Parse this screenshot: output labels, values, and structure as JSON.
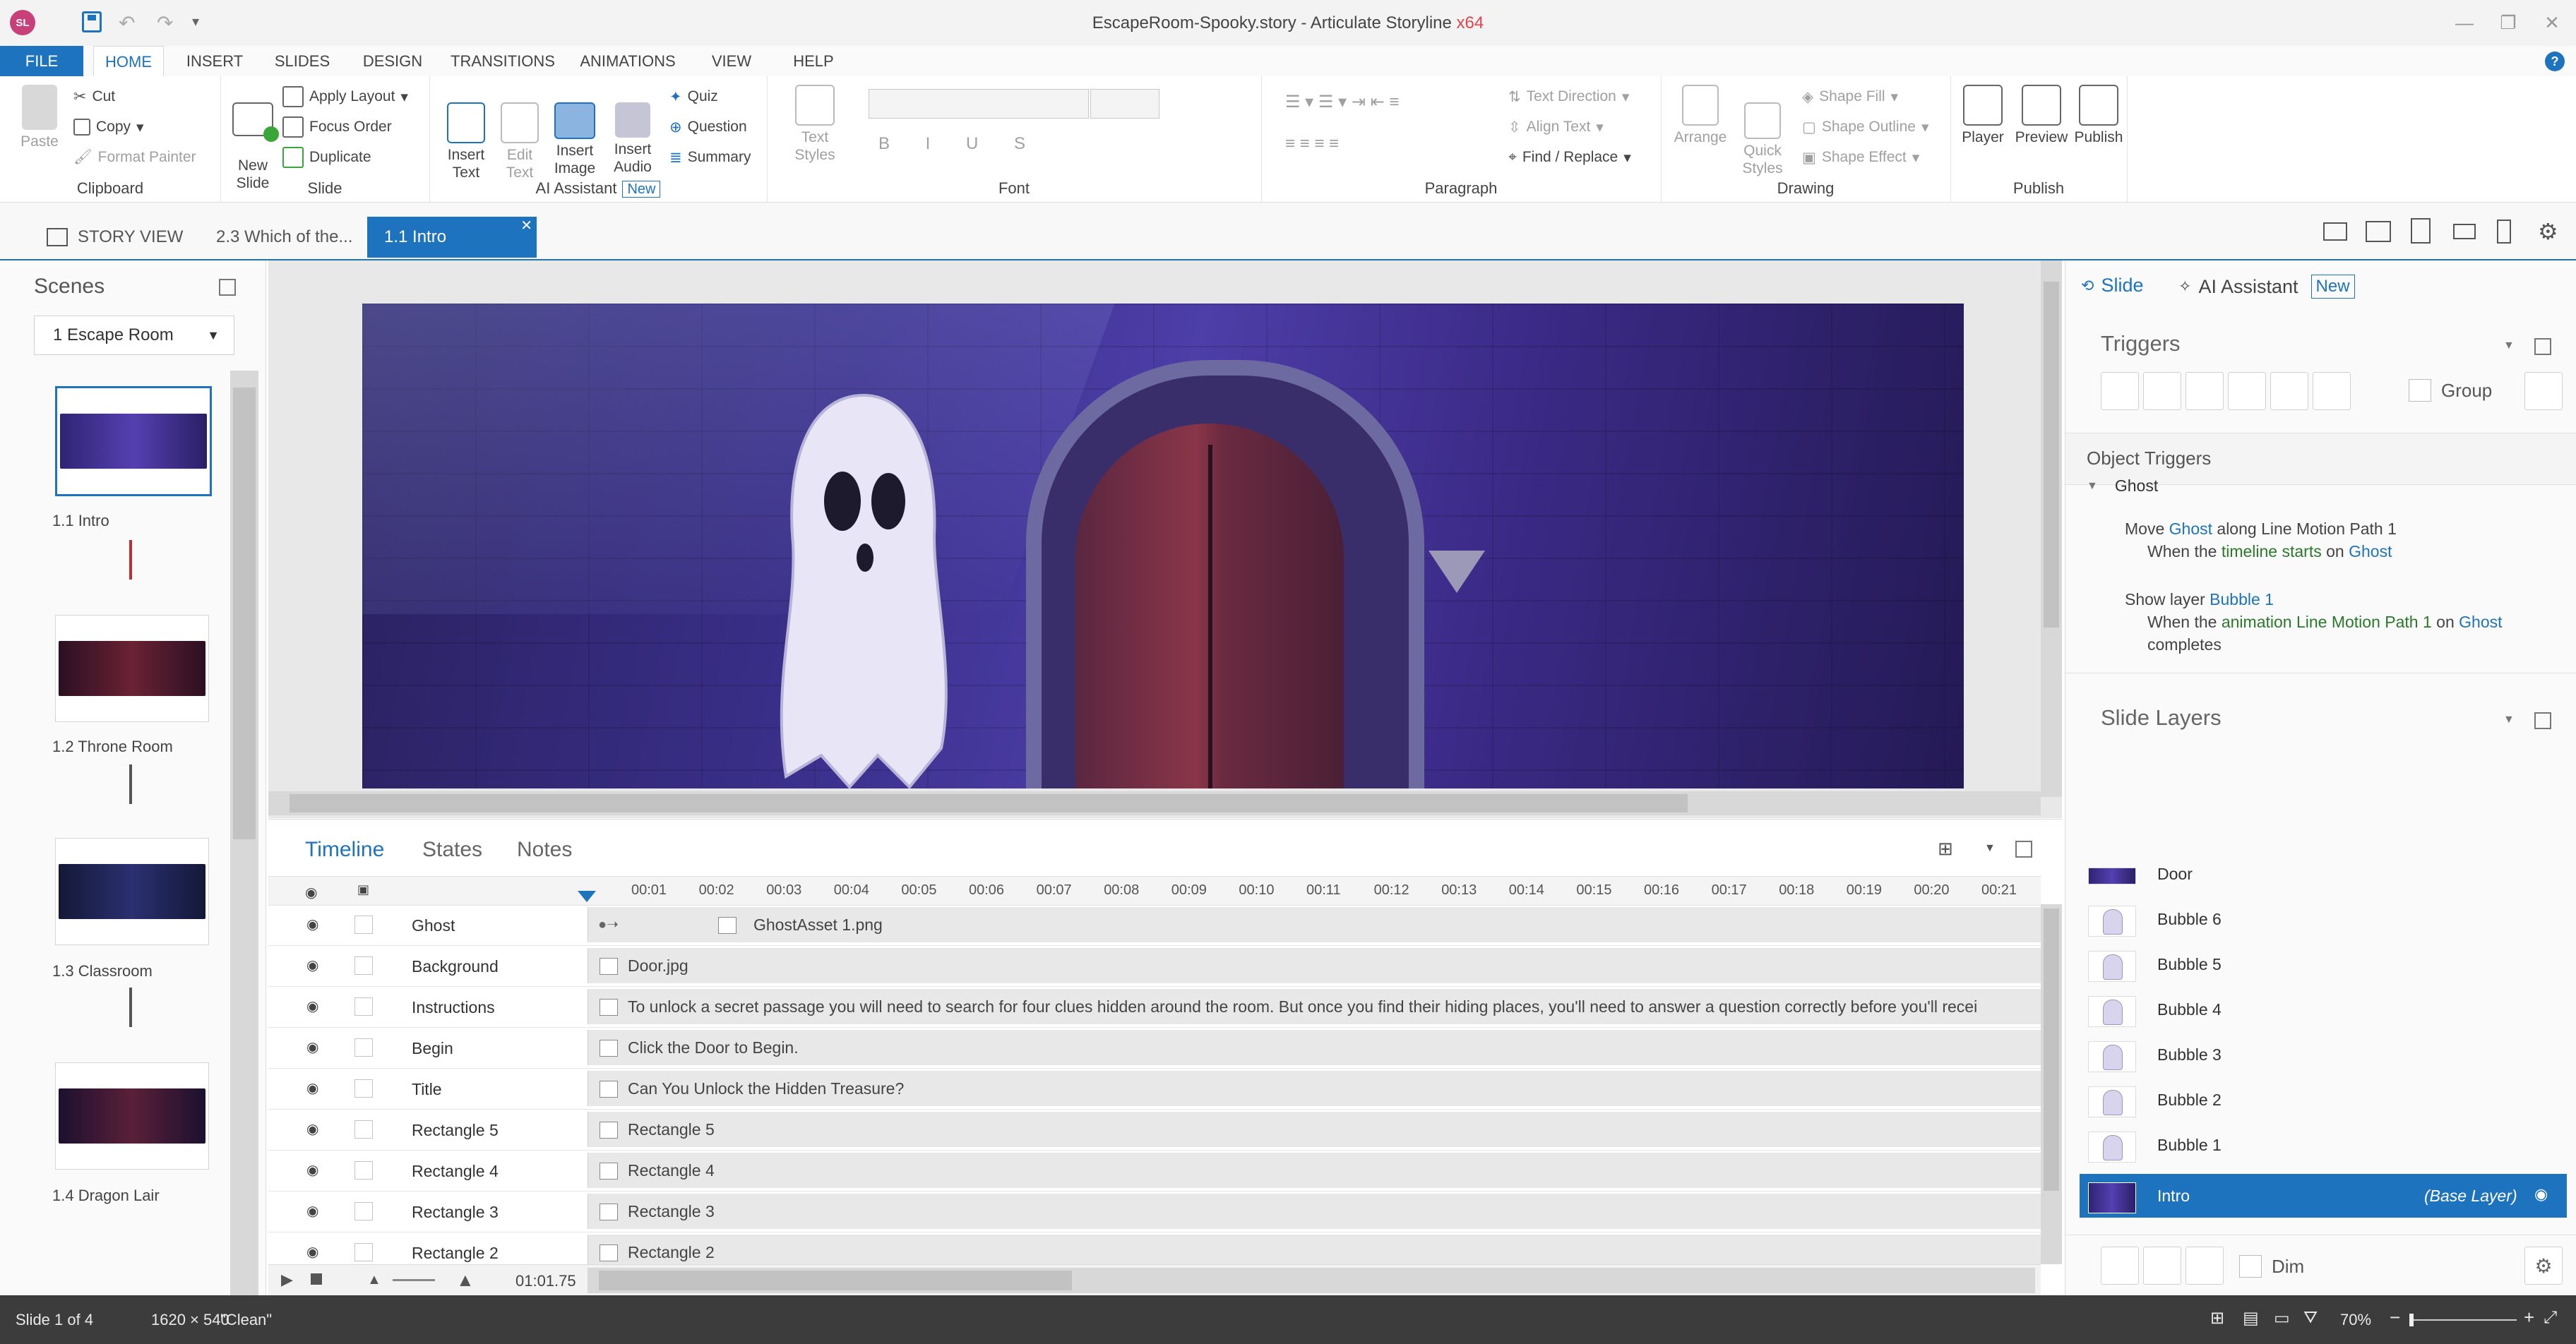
{
  "window": {
    "title": "EscapeRoom-Spooky.story - Articulate Storyline",
    "arch": "x64",
    "app_badge": "SL"
  },
  "menu": {
    "tabs": [
      "FILE",
      "HOME",
      "INSERT",
      "SLIDES",
      "DESIGN",
      "TRANSITIONS",
      "ANIMATIONS",
      "VIEW",
      "HELP"
    ],
    "active": "HOME"
  },
  "ribbon": {
    "clipboard": {
      "label": "Clipboard",
      "paste": "Paste",
      "cut": "Cut",
      "copy": "Copy",
      "format_painter": "Format Painter"
    },
    "slide": {
      "label": "Slide",
      "new_slide": "New\nSlide",
      "apply_layout": "Apply Layout",
      "focus_order": "Focus Order",
      "duplicate": "Duplicate"
    },
    "ai": {
      "label": "AI Assistant",
      "new_badge": "New",
      "insert_text": "Insert\nText",
      "edit_text": "Edit\nText",
      "insert_image": "Insert\nImage",
      "insert_audio": "Insert\nAudio",
      "quiz": "Quiz",
      "question": "Question",
      "summary": "Summary"
    },
    "font": {
      "label": "Font",
      "text_styles": "Text Styles"
    },
    "paragraph": {
      "label": "Paragraph",
      "text_direction": "Text Direction",
      "align_text": "Align Text",
      "find_replace": "Find / Replace"
    },
    "drawing": {
      "label": "Drawing",
      "arrange": "Arrange",
      "quick_styles": "Quick\nStyles",
      "shape_fill": "Shape Fill",
      "shape_outline": "Shape Outline",
      "shape_effect": "Shape Effect"
    },
    "publish": {
      "label": "Publish",
      "player": "Player",
      "preview": "Preview",
      "publish": "Publish"
    }
  },
  "view_tabs": {
    "story_view": "STORY VIEW",
    "tab2": "2.3 Which of the...",
    "tab3": "1.1 Intro"
  },
  "scenes": {
    "title": "Scenes",
    "dropdown": "1 Escape Room",
    "items": [
      {
        "label": "1.1 Intro",
        "color": "#3b2f84"
      },
      {
        "label": "1.2 Throne Room",
        "color": "#3a1830"
      },
      {
        "label": "1.3 Classroom",
        "color": "#1e2250"
      },
      {
        "label": "1.4 Dragon Lair",
        "color": "#3a1a2e"
      }
    ]
  },
  "timeline": {
    "tabs": [
      "Timeline",
      "States",
      "Notes"
    ],
    "ticks": [
      "00:01",
      "00:02",
      "00:03",
      "00:04",
      "00:05",
      "00:06",
      "00:07",
      "00:08",
      "00:09",
      "00:10",
      "00:11",
      "00:12",
      "00:13",
      "00:14",
      "00:15",
      "00:16",
      "00:17",
      "00:18",
      "00:19",
      "00:20",
      "00:21"
    ],
    "rows": [
      {
        "name": "Ghost",
        "bar": "GhostAsset 1.png"
      },
      {
        "name": "Background",
        "bar": "Door.jpg"
      },
      {
        "name": "Instructions",
        "bar": "To unlock a secret passage you will need to search for four clues hidden around the room. But once you find their hiding places, you'll need to answer a question correctly before you'll recei"
      },
      {
        "name": "Begin",
        "bar": "Click the Door to Begin."
      },
      {
        "name": "Title",
        "bar": "Can You Unlock the Hidden Treasure?"
      },
      {
        "name": "Rectangle 5",
        "bar": "Rectangle 5"
      },
      {
        "name": "Rectangle 4",
        "bar": "Rectangle 4"
      },
      {
        "name": "Rectangle 3",
        "bar": "Rectangle 3"
      },
      {
        "name": "Rectangle 2",
        "bar": "Rectangle 2"
      }
    ],
    "time": "01:01.75"
  },
  "right_panel": {
    "tab_slide": "Slide",
    "tab_ai": "AI Assistant",
    "tab_ai_badge": "New",
    "triggers_title": "Triggers",
    "group_label": "Group",
    "object_triggers": "Object Triggers",
    "ghost_group": "Ghost",
    "trigger1": {
      "a": "Move ",
      "b": "Ghost",
      "c": " along Line Motion Path 1",
      "d": "When the ",
      "e": "timeline starts",
      "f": " on ",
      "g": "Ghost"
    },
    "trigger2": {
      "a": "Show layer ",
      "b": "Bubble 1",
      "d": "When the ",
      "e": "animation Line Motion Path 1",
      "f": " on ",
      "g": "Ghost",
      "h": "completes"
    },
    "layers_title": "Slide Layers",
    "layers": [
      "Door",
      "Bubble 6",
      "Bubble 5",
      "Bubble 4",
      "Bubble 3",
      "Bubble 2",
      "Bubble 1"
    ],
    "base_layer": {
      "name": "Intro",
      "tag": "(Base Layer)"
    },
    "dim_label": "Dim"
  },
  "status": {
    "slide": "Slide 1 of 4",
    "size": "1620 × 540",
    "theme": "\"Clean\"",
    "zoom": "70%"
  }
}
